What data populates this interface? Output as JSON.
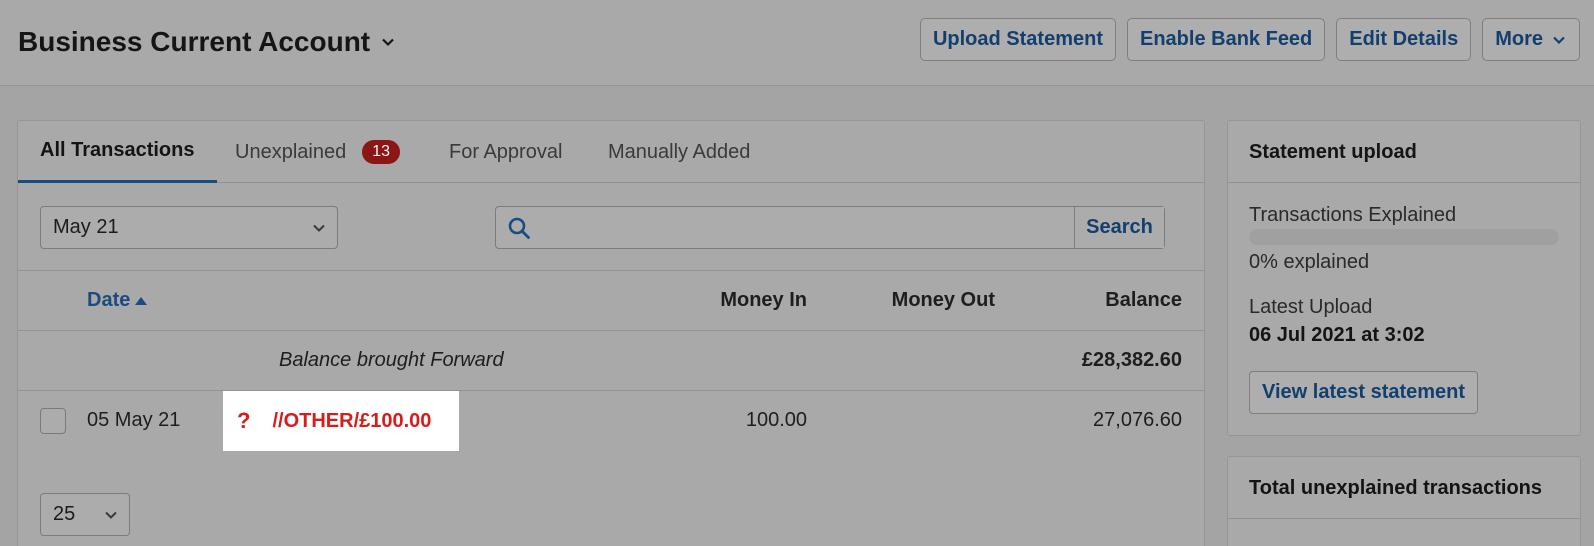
{
  "header": {
    "account_title": "Business Current Account",
    "buttons": {
      "upload": "Upload Statement",
      "bank_feed": "Enable Bank Feed",
      "edit": "Edit Details",
      "more": "More"
    }
  },
  "tabs": {
    "all": "All Transactions",
    "unexplained": "Unexplained",
    "unexplained_count": "13",
    "approval": "For Approval",
    "manual": "Manually Added"
  },
  "filters": {
    "month": "May 21",
    "search_button": "Search",
    "search_value": ""
  },
  "table": {
    "headers": {
      "date": "Date",
      "money_in": "Money In",
      "money_out": "Money Out",
      "balance": "Balance"
    },
    "brought_forward": {
      "label": "Balance brought Forward",
      "balance": "£28,382.60"
    },
    "rows": [
      {
        "date": "05 May 21",
        "description": "//OTHER/£100.00",
        "money_in": "100.00",
        "money_out": "",
        "balance": "27,076.60"
      }
    ]
  },
  "pagination": {
    "per_page": "25"
  },
  "statement_upload": {
    "title": "Statement upload",
    "explained_label": "Transactions Explained",
    "explained_fraction": 0,
    "explained_text": "0% explained",
    "latest_label": "Latest Upload",
    "latest_value": "06 Jul 2021 at 3:02",
    "view_button": "View latest statement"
  },
  "unexplained_panel": {
    "title": "Total unexplained transactions"
  },
  "colors": {
    "accent": "#1a4c82",
    "badge": "#8a1616",
    "unexplained_text": "#d81c1c"
  }
}
